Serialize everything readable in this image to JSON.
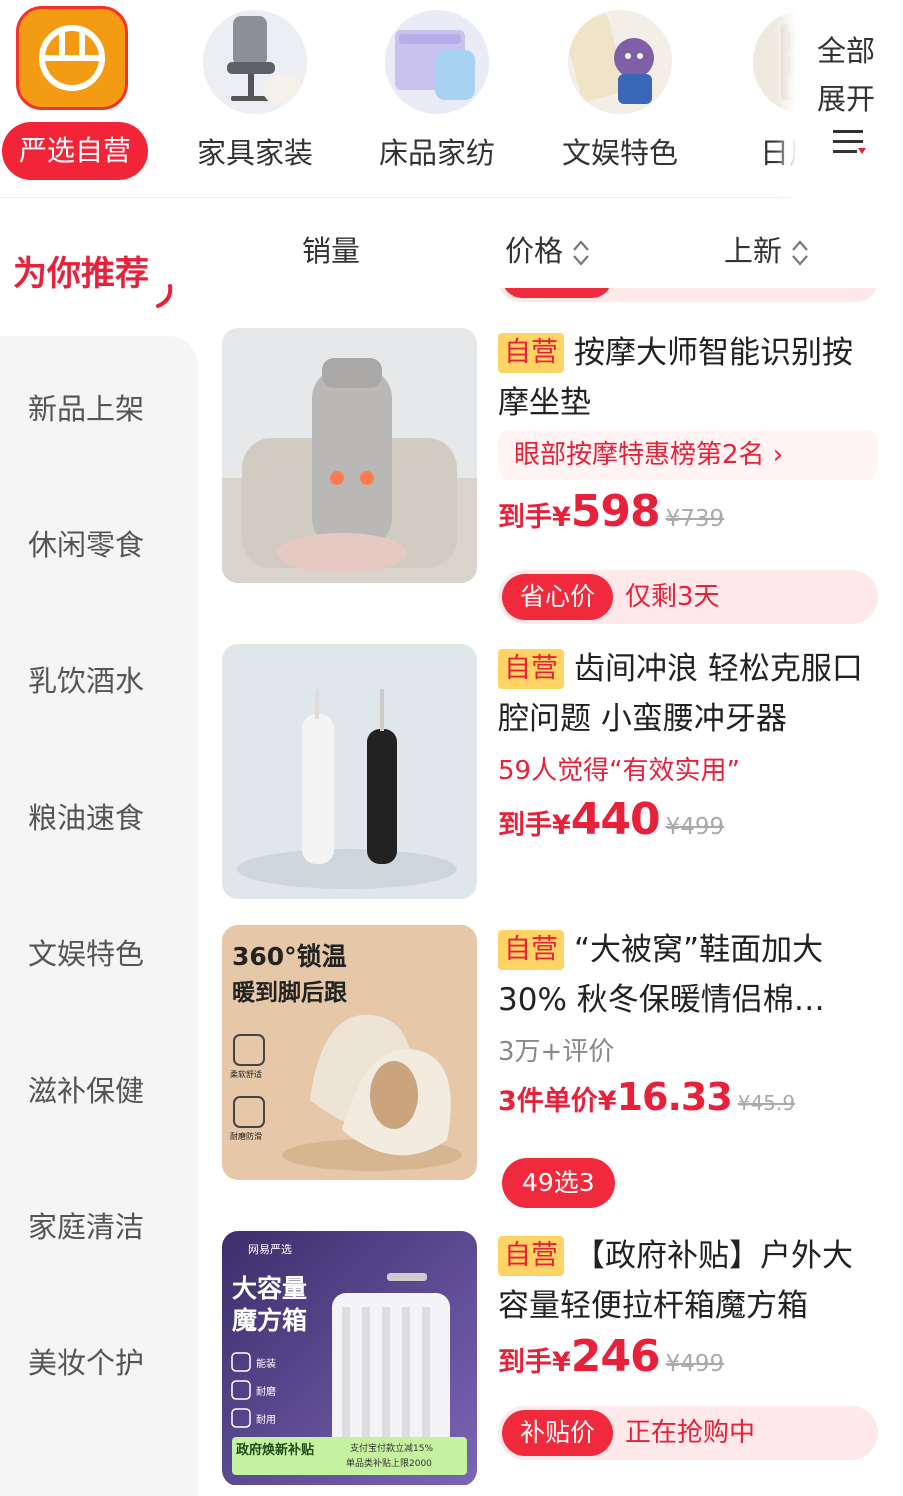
{
  "top_categories": [
    {
      "label": "严选自营",
      "icon": "yanxuan-logo-icon",
      "active": true
    },
    {
      "label": "家具家装",
      "icon": "office-chair-icon"
    },
    {
      "label": "床品家纺",
      "icon": "bedding-icon"
    },
    {
      "label": "文娱特色",
      "icon": "toy-figure-icon"
    },
    {
      "label": "日用",
      "icon": "storage-cabinet-icon"
    }
  ],
  "all_button": {
    "line1": "全部",
    "line2": "展开",
    "icon": "menu-icon"
  },
  "sidebar": {
    "title": "为你推荐",
    "items": [
      "新品上架",
      "休闲零食",
      "乳饮酒水",
      "粮油速食",
      "文娱特色",
      "滋补保健",
      "家庭清洁",
      "美妆个护"
    ]
  },
  "sort_bar": {
    "sales": "销量",
    "price": "价格",
    "newest": "上新"
  },
  "products": [
    {
      "badge": "自营",
      "title": "按摩大师智能识别按摩坐垫",
      "rank": "眼部按摩特惠榜第2名",
      "price_prefix": "到手¥",
      "price": "598",
      "original_price": "¥739",
      "tag_pill": "省心价",
      "tag_text": "仅剩3天",
      "image": "massage-cushion"
    },
    {
      "badge": "自营",
      "title": "齿间冲浪 轻松克服口腔问题 小蛮腰冲牙器",
      "sub": "59人觉得“有效实用”",
      "price_prefix": "到手¥",
      "price": "440",
      "original_price": "¥499",
      "image": "water-flosser"
    },
    {
      "badge": "自营",
      "title": "“大被窝”鞋面加大30% 秋冬保暖情侣棉…",
      "sub": "3万+评价",
      "price_prefix": "3件单价¥",
      "price": "16.33",
      "original_price": "¥45.9",
      "solo_tag": "49选3",
      "image": "cotton-slippers",
      "overlay": {
        "line1": "360°锁温",
        "line2": "暖到脚后跟",
        "feat1": "柔软舒适",
        "feat2": "耐磨防滑"
      }
    },
    {
      "badge": "自营",
      "title": "【政府补贴】户外大容量轻便拉杆箱魔方箱",
      "price_prefix": "到手¥",
      "price": "246",
      "original_price": "¥499",
      "tag_pill": "补贴价",
      "tag_text": "正在抢购中",
      "image": "luggage",
      "overlay": {
        "brand": "网易严选",
        "line1": "大容量",
        "line2": "魔方箱",
        "feat1": "能装",
        "feat2": "耐磨",
        "feat3": "耐用",
        "promo": "政府焕新补贴",
        "promo2": "支付宝付款立减15%",
        "promo3": "单品类补贴上限2000"
      }
    }
  ],
  "colors": {
    "accent": "#e8203a",
    "badge_bg": "#ffd464",
    "logo_orange": "#f39b13"
  }
}
